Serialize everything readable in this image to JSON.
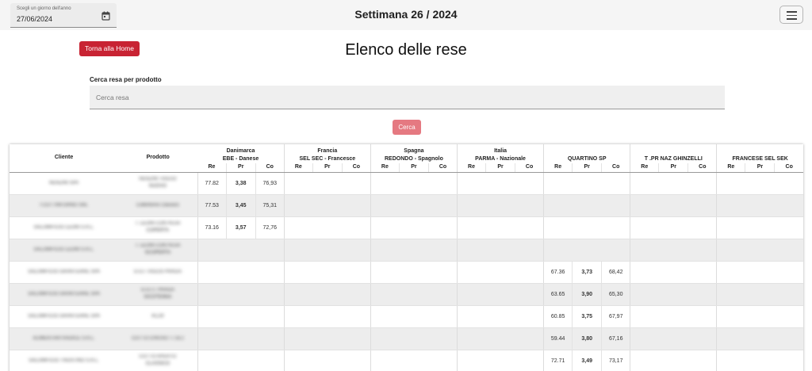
{
  "header": {
    "date_label": "Scegli un giorno dell'anno",
    "date_value": "27/06/2024",
    "week_title": "Settimana 26 / 2024"
  },
  "main": {
    "home_button": "Torna alla Home",
    "page_title": "Elenco delle rese",
    "search_label": "Cerca resa per prodotto",
    "search_placeholder": "Cerca resa",
    "search_button": "Cerca"
  },
  "table": {
    "col_cliente": "Cliente",
    "col_prodotto": "Prodotto",
    "sub_re": "Re",
    "sub_pr": "Pr",
    "sub_co": "Co",
    "groups": [
      {
        "line1": "Danimarca",
        "line2": "EBE - Danese"
      },
      {
        "line1": "Francia",
        "line2": "SEL SEC - Francesce"
      },
      {
        "line1": "Spagna",
        "line2": "REDONDO - Spagnolo"
      },
      {
        "line1": "Italia",
        "line2": "PARMA - Nazionale"
      },
      {
        "line1": "QUARTINO SP",
        "line2": ""
      },
      {
        "line1": "T .PR NAZ GHINZELLI",
        "line2": ""
      },
      {
        "line1": "FRANCESE SEL SEK",
        "line2": ""
      }
    ],
    "rows": [
      {
        "cliente": "RENZINI SPA",
        "prodotto": "RENZINI TAGLIO NUOVO",
        "values": [
          [
            "77.82",
            "3,38",
            "76,93"
          ],
          null,
          null,
          null,
          null,
          null,
          null
        ]
      },
      {
        "cliente": "I COTTINFORNO SRL",
        "prodotto": "Cottinforno Classico",
        "values": [
          [
            "77.53",
            "3,45",
            "75,31"
          ],
          null,
          null,
          null,
          null,
          null,
          null
        ]
      },
      {
        "cliente": "SALUMIFICIO LEONI S.R.L.",
        "prodotto": "T. LEONI CON PESA COPERTA",
        "values": [
          [
            "73.16",
            "3,57",
            "72,76"
          ],
          null,
          null,
          null,
          null,
          null,
          null
        ]
      },
      {
        "cliente": "SALUMIFICIO LEONI S.R.L.",
        "prodotto": "T. LEONI CON PESA SCOPERTA",
        "values": [
          null,
          null,
          null,
          null,
          null,
          null,
          null
        ]
      },
      {
        "cliente": "SALUMIFICIO GRANTERRE SPA",
        "prodotto": "G.G.I TAGLIO PRAGA",
        "values": [
          null,
          null,
          null,
          null,
          [
            "67.36",
            "3,73",
            "68,42"
          ],
          null,
          null
        ]
      },
      {
        "cliente": "SALUMIFICIO GRANTERRE SPA",
        "prodotto": "G.G.I.I. PRAGA S/COTENNA",
        "values": [
          null,
          null,
          null,
          null,
          [
            "63.65",
            "3,90",
            "65,30"
          ],
          null,
          null
        ]
      },
      {
        "cliente": "SALUMIFICIO GRANTERRE SPA",
        "prodotto": "KC29",
        "values": [
          null,
          null,
          null,
          null,
          [
            "60.85",
            "3,75",
            "67,97"
          ],
          null,
          null
        ]
      },
      {
        "cliente": "ALIMENTARI RADICE S.R.L.",
        "prodotto": "COTTO CHIUSO T.T.B.2",
        "values": [
          null,
          null,
          null,
          null,
          [
            "59.44",
            "3,80",
            "67,16"
          ],
          null,
          null
        ]
      },
      {
        "cliente": "SALUMIFICIO TRENTINO S.R.L.",
        "prodotto": "COTTO APERTO CLASSICO",
        "values": [
          null,
          null,
          null,
          null,
          [
            "72.71",
            "3,49",
            "73,17"
          ],
          null,
          null
        ]
      }
    ]
  },
  "colors": {
    "home_button": "#c82333",
    "search_button": "#e57981",
    "stripe": "#ededed"
  },
  "icons": {
    "date": "calendar-icon",
    "menu": "hamburger-menu-icon"
  }
}
